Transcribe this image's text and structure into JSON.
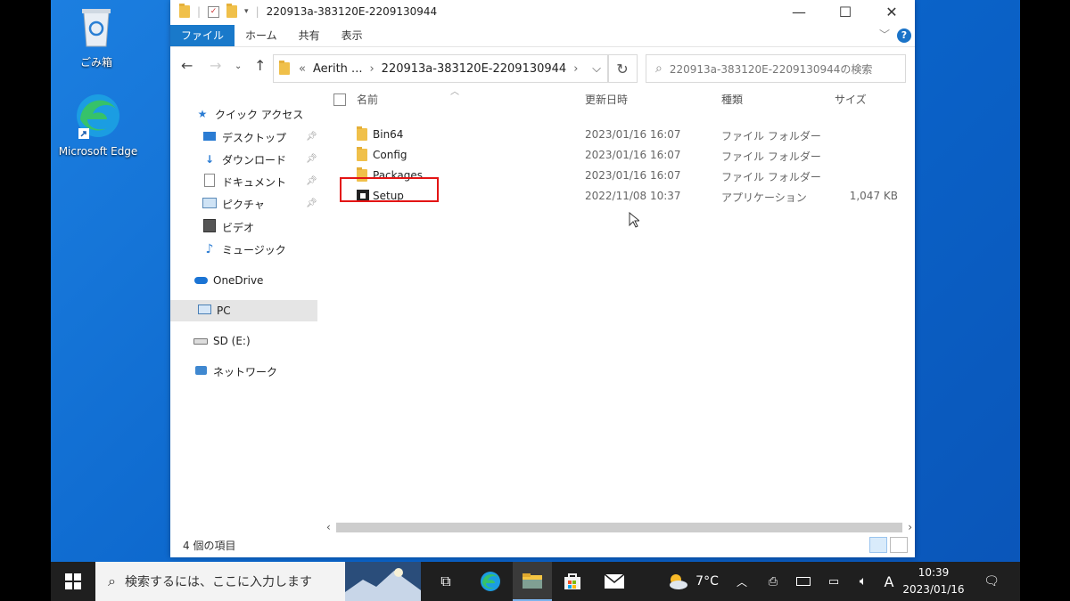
{
  "desktop": {
    "icons": [
      {
        "label": "ごみ箱",
        "icon": "recycle-bin-icon"
      },
      {
        "label": "Microsoft Edge",
        "icon": "edge-icon"
      }
    ]
  },
  "window": {
    "title": "220913a-383120E-2209130944",
    "ribbon_tabs": [
      "ファイル",
      "ホーム",
      "共有",
      "表示"
    ],
    "help_label": "?",
    "address": {
      "prefix": "«",
      "segments": [
        "Aerith ...",
        "220913a-383120E-2209130944"
      ]
    },
    "search_placeholder": "220913a-383120E-2209130944の検索",
    "nav": {
      "quick_access": "クイック アクセス",
      "items": [
        {
          "label": "デスクトップ",
          "pinned": true
        },
        {
          "label": "ダウンロード",
          "pinned": true
        },
        {
          "label": "ドキュメント",
          "pinned": true
        },
        {
          "label": "ピクチャ",
          "pinned": true
        },
        {
          "label": "ビデオ",
          "pinned": false
        },
        {
          "label": "ミュージック",
          "pinned": false
        }
      ],
      "onedrive": "OneDrive",
      "pc": "PC",
      "sd": "SD (E:)",
      "network": "ネットワーク"
    },
    "columns": {
      "name": "名前",
      "date": "更新日時",
      "type": "種類",
      "size": "サイズ"
    },
    "files": [
      {
        "name": "Bin64",
        "date": "2023/01/16 16:07",
        "type": "ファイル フォルダー",
        "size": ""
      },
      {
        "name": "Config",
        "date": "2023/01/16 16:07",
        "type": "ファイル フォルダー",
        "size": ""
      },
      {
        "name": "Packages",
        "date": "2023/01/16 16:07",
        "type": "ファイル フォルダー",
        "size": ""
      },
      {
        "name": "Setup",
        "date": "2022/11/08 10:37",
        "type": "アプリケーション",
        "size": "1,047 KB"
      }
    ],
    "status": "4 個の項目"
  },
  "taskbar": {
    "search_placeholder": "検索するには、ここに入力します",
    "weather": "7°C",
    "ime": "A",
    "time": "10:39",
    "date": "2023/01/16"
  },
  "colors": {
    "highlight": "#e31414",
    "accent": "#1979ca",
    "desktop": "#0a63c9"
  }
}
